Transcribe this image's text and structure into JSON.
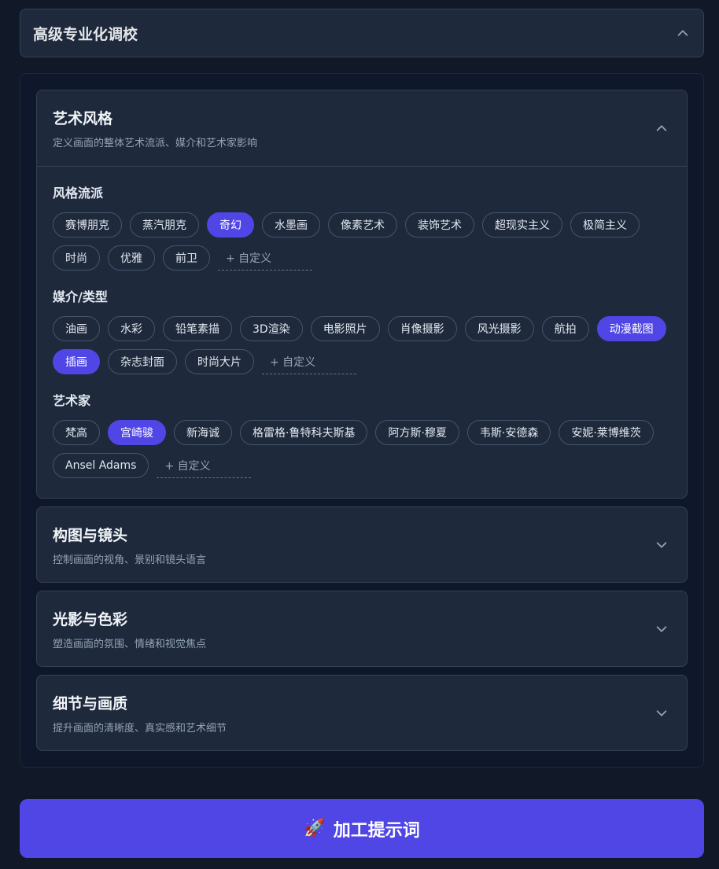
{
  "panel": {
    "title": "高级专业化调校"
  },
  "cards": [
    {
      "title": "艺术风格",
      "subtitle": "定义画面的整体艺术流派、媒介和艺术家影响",
      "expanded": true,
      "groups": [
        {
          "title": "风格流派",
          "chips": [
            {
              "label": "赛博朋克",
              "active": false
            },
            {
              "label": "蒸汽朋克",
              "active": false
            },
            {
              "label": "奇幻",
              "active": true
            },
            {
              "label": "水墨画",
              "active": false
            },
            {
              "label": "像素艺术",
              "active": false
            },
            {
              "label": "装饰艺术",
              "active": false
            },
            {
              "label": "超现实主义",
              "active": false
            },
            {
              "label": "极简主义",
              "active": false
            },
            {
              "label": "时尚",
              "active": false
            },
            {
              "label": "优雅",
              "active": false
            },
            {
              "label": "前卫",
              "active": false
            }
          ],
          "custom_label": "+ 自定义"
        },
        {
          "title": "媒介/类型",
          "chips": [
            {
              "label": "油画",
              "active": false
            },
            {
              "label": "水彩",
              "active": false
            },
            {
              "label": "铅笔素描",
              "active": false
            },
            {
              "label": "3D渲染",
              "active": false
            },
            {
              "label": "电影照片",
              "active": false
            },
            {
              "label": "肖像摄影",
              "active": false
            },
            {
              "label": "风光摄影",
              "active": false
            },
            {
              "label": "航拍",
              "active": false
            },
            {
              "label": "动漫截图",
              "active": true
            },
            {
              "label": "插画",
              "active": true
            },
            {
              "label": "杂志封面",
              "active": false
            },
            {
              "label": "时尚大片",
              "active": false
            }
          ],
          "custom_label": "+ 自定义"
        },
        {
          "title": "艺术家",
          "chips": [
            {
              "label": "梵高",
              "active": false
            },
            {
              "label": "宫崎骏",
              "active": true
            },
            {
              "label": "新海诚",
              "active": false
            },
            {
              "label": "格雷格·鲁特科夫斯基",
              "active": false
            },
            {
              "label": "阿方斯·穆夏",
              "active": false
            },
            {
              "label": "韦斯·安德森",
              "active": false
            },
            {
              "label": "安妮·莱博维茨",
              "active": false
            },
            {
              "label": "Ansel Adams",
              "active": false
            }
          ],
          "custom_label": "+ 自定义"
        }
      ]
    },
    {
      "title": "构图与镜头",
      "subtitle": "控制画面的视角、景别和镜头语言",
      "expanded": false
    },
    {
      "title": "光影与色彩",
      "subtitle": "塑造画面的氛围、情绪和视觉焦点",
      "expanded": false
    },
    {
      "title": "细节与画质",
      "subtitle": "提升画面的清晰度、真实感和艺术细节",
      "expanded": false
    }
  ],
  "submit": {
    "icon": "rocket-icon",
    "label": "加工提示词"
  },
  "colors": {
    "accent": "#4f46e5",
    "background": "#111827",
    "card": "#1e293b",
    "border": "#334155"
  }
}
